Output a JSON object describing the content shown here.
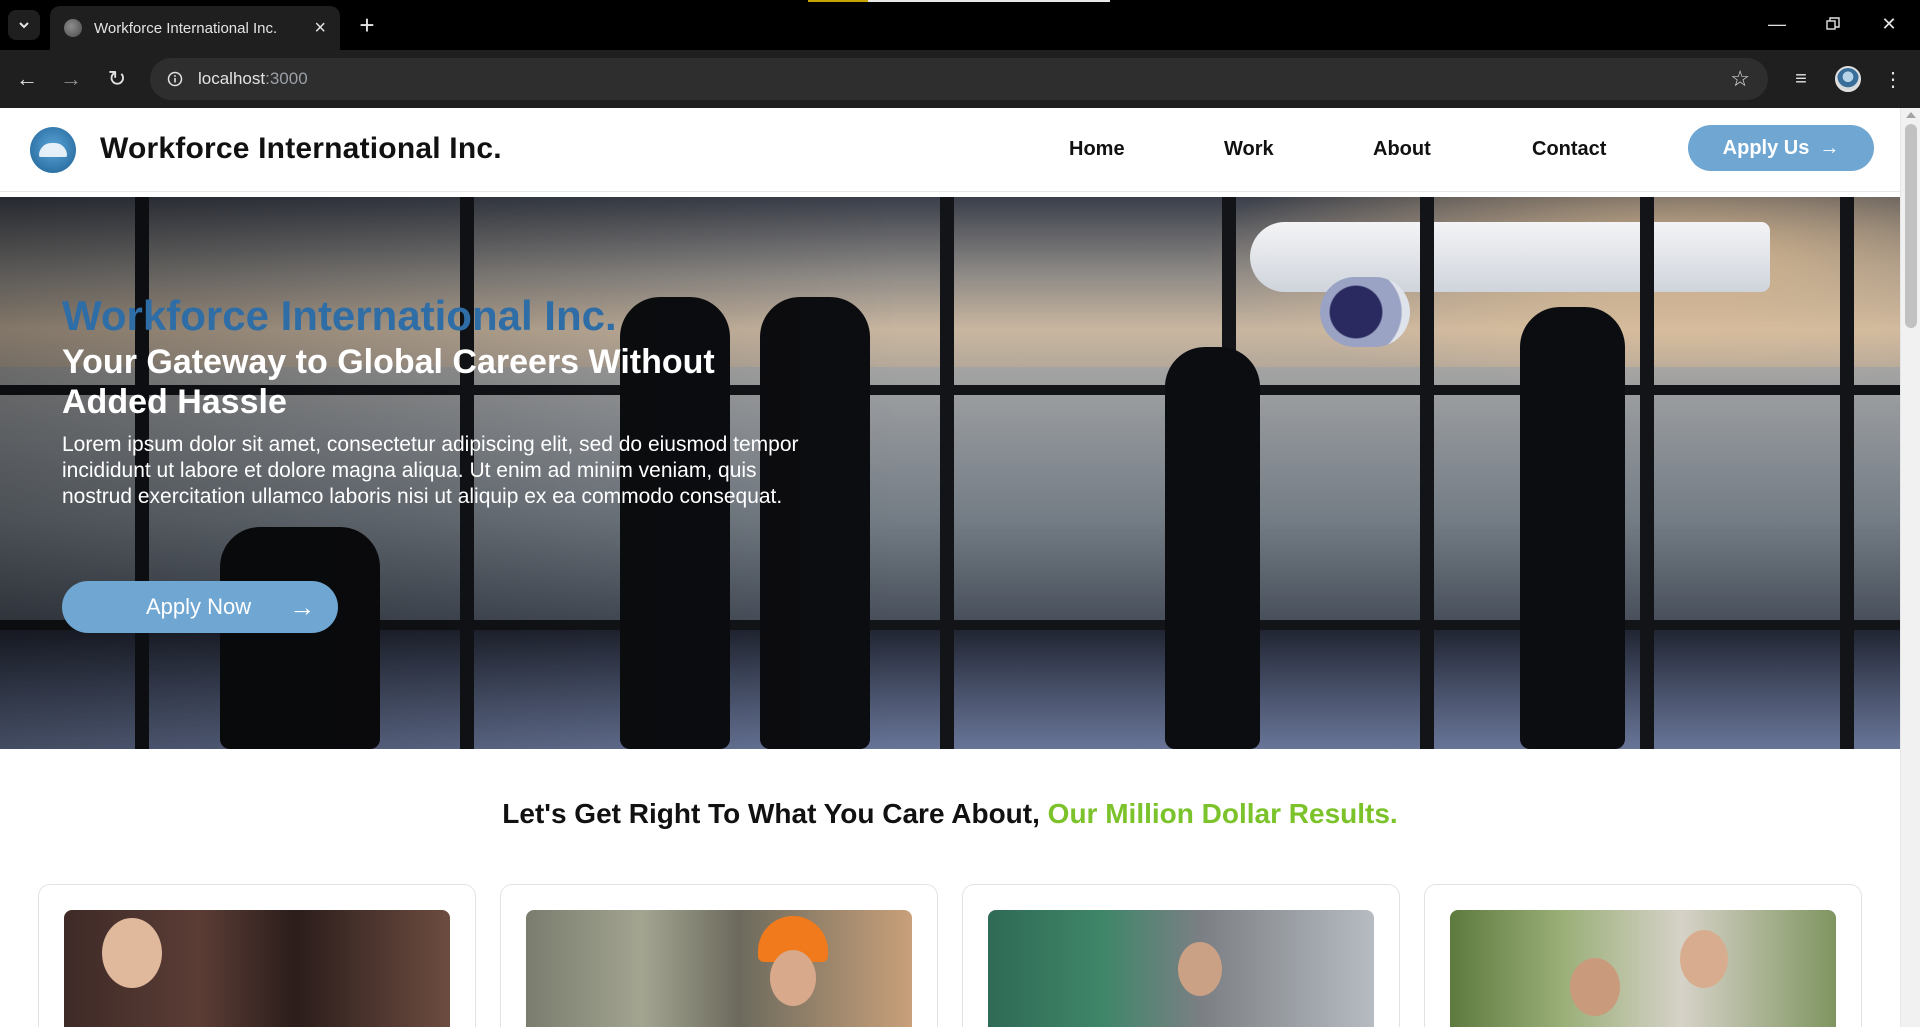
{
  "browser": {
    "tab_title": "Workforce International Inc.",
    "url_host": "localhost",
    "url_port": ":3000"
  },
  "site": {
    "brand": "Workforce International Inc.",
    "nav": [
      "Home",
      "Work",
      "About",
      "Contact"
    ],
    "cta": "Apply Us",
    "cta_arrow": "→"
  },
  "hero": {
    "kicker": "Workforce International Inc.",
    "title": "Your Gateway to Global Careers Without Added Hassle",
    "text": "Lorem ipsum dolor sit amet, consectetur adipiscing elit, sed do eiusmod tempor incididunt ut labore et dolore magna aliqua. Ut enim ad minim veniam, quis nostrud exercitation ullamco laboris nisi ut aliquip ex ea commodo consequat.",
    "button": "Apply Now",
    "button_arrow": "→"
  },
  "results": {
    "heading": "Let's Get Right To What You Care About, ",
    "heading_accent": "Our Million Dollar Results."
  },
  "colors": {
    "accent_blue": "#6fa6d2",
    "brand_blue": "#2e6da6",
    "accent_green": "#7cc22a"
  }
}
